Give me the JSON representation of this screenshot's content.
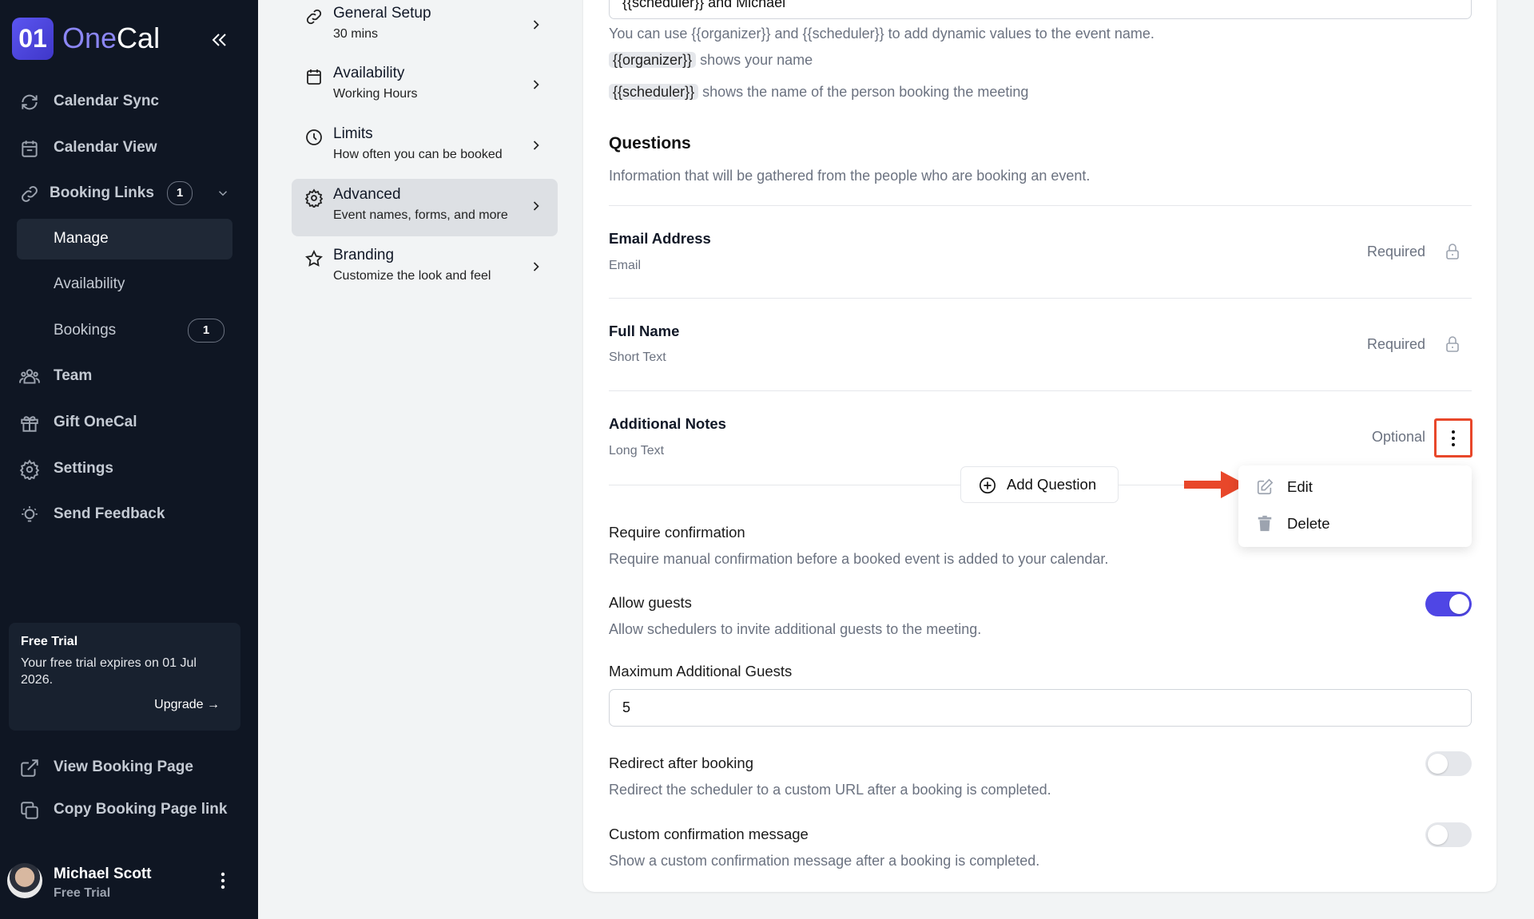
{
  "app": {
    "name_one": "One",
    "name_cal": "Cal",
    "logo_mark": "01",
    "brand_color": "#4f46e5"
  },
  "sidebar": {
    "items": [
      {
        "label": "Calendar Sync",
        "icon": "refresh-icon"
      },
      {
        "label": "Calendar View",
        "icon": "calendar-icon"
      },
      {
        "label": "Booking Links",
        "icon": "link-icon",
        "badge": "1"
      },
      {
        "label": "Manage",
        "active": true
      },
      {
        "label": "Availability"
      },
      {
        "label": "Bookings",
        "badge": "1"
      },
      {
        "label": "Team",
        "icon": "team-icon"
      },
      {
        "label": "Gift OneCal",
        "icon": "gift-icon"
      },
      {
        "label": "Settings",
        "icon": "gear-icon"
      },
      {
        "label": "Send Feedback",
        "icon": "lightbulb-icon"
      }
    ],
    "trial": {
      "title": "Free Trial",
      "text": "Your free trial expires on 01 Jul 2026.",
      "upgrade": "Upgrade →"
    },
    "links": [
      {
        "label": "View Booking Page",
        "icon": "external-link-icon"
      },
      {
        "label": "Copy Booking Page link",
        "icon": "copy-icon"
      }
    ],
    "user": {
      "name": "Michael Scott",
      "plan": "Free Trial"
    }
  },
  "settings_nav": [
    {
      "title": "General Setup",
      "subtitle": "30 mins",
      "icon": "link-icon"
    },
    {
      "title": "Availability",
      "subtitle": "Working Hours",
      "icon": "calendar-icon"
    },
    {
      "title": "Limits",
      "subtitle": "How often you can be booked",
      "icon": "clock-icon"
    },
    {
      "title": "Advanced",
      "subtitle": "Event names, forms, and more",
      "icon": "gear-icon",
      "active": true
    },
    {
      "title": "Branding",
      "subtitle": "Customize the look and feel",
      "icon": "star-icon"
    }
  ],
  "main": {
    "event_name_value": "{{scheduler}} and Michael",
    "help": "You can use {{organizer}} and {{scheduler}} to add dynamic values to the event name.",
    "chip_organizer": "{{organizer}}",
    "chip_organizer_text": "shows your name",
    "chip_scheduler": "{{scheduler}}",
    "chip_scheduler_text": "shows the name of the person booking the meeting",
    "questions": {
      "title": "Questions",
      "desc": "Information that will be gathered from the people who are booking an event.",
      "items": [
        {
          "label": "Email Address",
          "type": "Email",
          "status": "Required"
        },
        {
          "label": "Full Name",
          "type": "Short Text",
          "status": "Required"
        },
        {
          "label": "Additional Notes",
          "type": "Long Text",
          "status": "Optional"
        }
      ],
      "add_label": "Add Question"
    },
    "menu": {
      "edit": "Edit",
      "delete": "Delete"
    },
    "require_confirmation": {
      "label": "Require confirmation",
      "desc": "Require manual confirmation before a booked event is added to your calendar."
    },
    "allow_guests": {
      "label": "Allow guests",
      "desc": "Allow schedulers to invite additional guests to the meeting.",
      "enabled": true
    },
    "max_guests": {
      "label": "Maximum Additional Guests",
      "value": "5"
    },
    "redirect": {
      "label": "Redirect after booking",
      "desc": "Redirect the scheduler to a custom URL after a booking is completed.",
      "enabled": false
    },
    "custom_message": {
      "label": "Custom confirmation message",
      "desc": "Show a custom confirmation message after a booking is completed.",
      "enabled": false
    }
  },
  "colors": {
    "annotation": "#e8472a",
    "toggle_on": "#4f46e5"
  }
}
